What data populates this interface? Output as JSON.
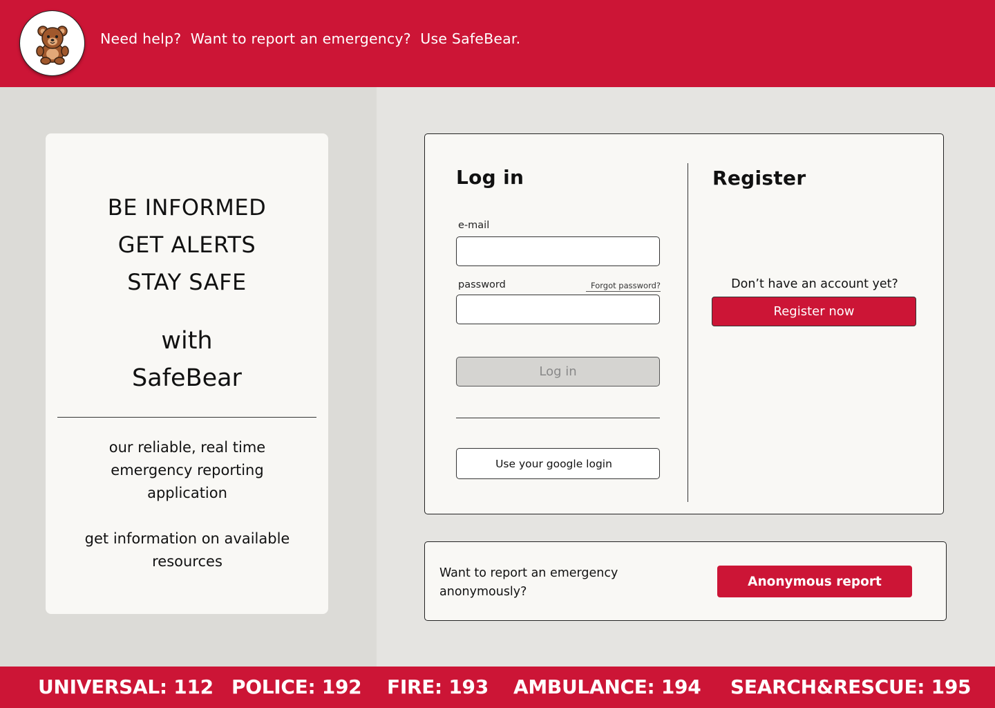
{
  "header": {
    "tagline": "Need help?  Want to report an emergency?  Use SafeBear.",
    "logo_icon": "teddy-bear-icon",
    "background_color": "#cc1536"
  },
  "info_card": {
    "slogan": [
      "BE INFORMED",
      "GET ALERTS",
      "STAY SAFE"
    ],
    "with": "with",
    "brand": "SafeBear",
    "description": "our reliable, real time emergency reporting application",
    "resources": "get information on available resources"
  },
  "login": {
    "title": "Log in",
    "email_label": "e-mail",
    "email_value": "",
    "password_label": "password",
    "password_value": "",
    "forgot_password": "Forgot password?",
    "login_button": "Log in",
    "google_button": "Use your google login"
  },
  "register": {
    "title": "Register",
    "question": "Don’t have an account yet?",
    "button": "Register now"
  },
  "anonymous": {
    "question": "Want to report an emergency anonymously?",
    "button": "Anonymous report"
  },
  "footer": {
    "hotlines": [
      "UNIVERSAL: 112",
      "POLICE: 192",
      "FIRE: 193",
      "AMBULANCE: 194",
      "SEARCH&RESCUE: 195"
    ]
  },
  "colors": {
    "accent": "#cc1536",
    "card_background": "#f9f8f5",
    "disabled_button": "#d5d4d1"
  }
}
